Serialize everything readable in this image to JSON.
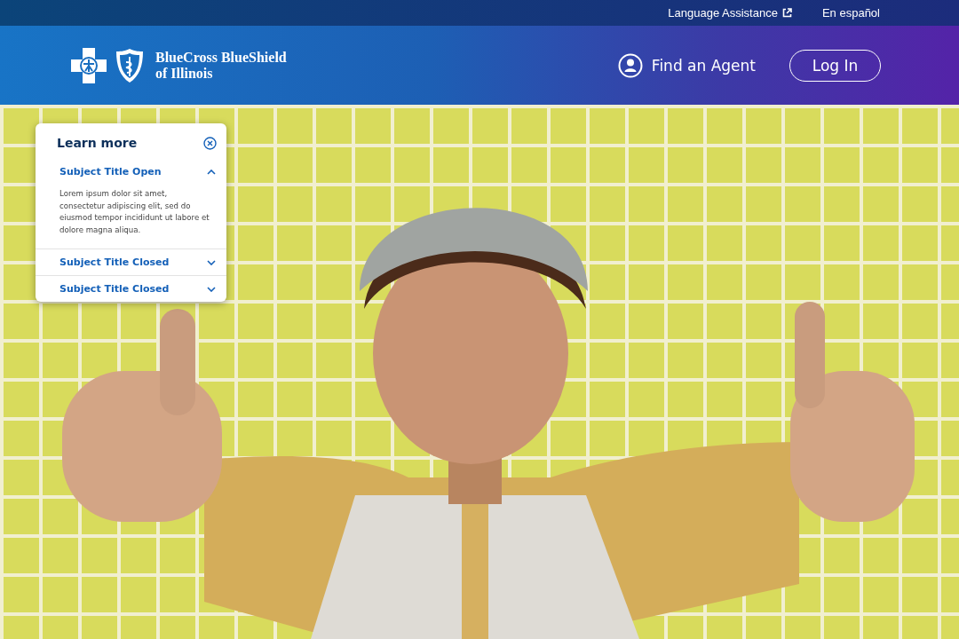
{
  "utility_bar": {
    "links": [
      {
        "label": "Language Assistance",
        "external": true
      },
      {
        "label": "En español",
        "external": false
      }
    ]
  },
  "header": {
    "logo": {
      "line_1": "BlueCross BlueShield",
      "line_2": "of Illinois"
    },
    "find_agent": "Find an Agent",
    "login": "Log In"
  },
  "learn_more": {
    "title": "Learn more",
    "sections": [
      {
        "title": "Subject Title Open",
        "expanded": true,
        "body": "Lorem ipsum dolor sit amet, consectetur adipiscing elit, sed do eiusmod tempor incididunt ut labore et dolore magna aliqua."
      },
      {
        "title": "Subject Title Closed",
        "expanded": false
      },
      {
        "title": "Subject Title Closed",
        "expanded": false
      }
    ]
  }
}
